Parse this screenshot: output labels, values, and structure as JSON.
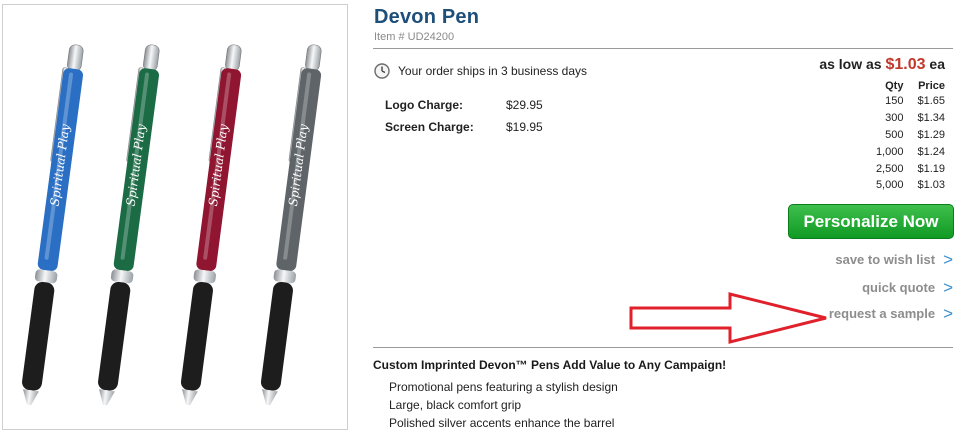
{
  "product": {
    "title": "Devon Pen",
    "item_number": "Item # UD24200",
    "ship_text": "Your order ships in 3 business days",
    "charges": [
      {
        "label": "Logo Charge:",
        "value": "$29.95"
      },
      {
        "label": "Screen Charge:",
        "value": "$19.95"
      }
    ],
    "low_prefix": "as low as",
    "low_price": "$1.03",
    "low_suffix": "ea",
    "price_table": {
      "headers": [
        "Qty",
        "Price"
      ],
      "rows": [
        [
          "150",
          "$1.65"
        ],
        [
          "300",
          "$1.34"
        ],
        [
          "500",
          "$1.29"
        ],
        [
          "1,000",
          "$1.24"
        ],
        [
          "2,500",
          "$1.19"
        ],
        [
          "5,000",
          "$1.03"
        ]
      ]
    }
  },
  "actions": {
    "personalize": "Personalize Now",
    "wishlist": "save to wish list",
    "quote": "quick quote",
    "sample": "request a sample",
    "chevron": ">"
  },
  "description": {
    "heading": "Custom Imprinted Devon™ Pens Add Value to Any Campaign!",
    "bullets": [
      "Promotional pens featuring a stylish design",
      "Large, black comfort grip",
      "Polished silver accents enhance the barrel"
    ]
  },
  "image": {
    "imprint_text": "Spiritual Play",
    "pen_colors": [
      "#2a6fc4",
      "#1b6b45",
      "#8f1530",
      "#5e6468"
    ]
  },
  "colors": {
    "title": "#1e4f7a",
    "price_accent": "#c0392b",
    "button_green": "#1aa32d",
    "chevron_blue": "#3a8fd0",
    "annotation_arrow": "#e0202a"
  }
}
